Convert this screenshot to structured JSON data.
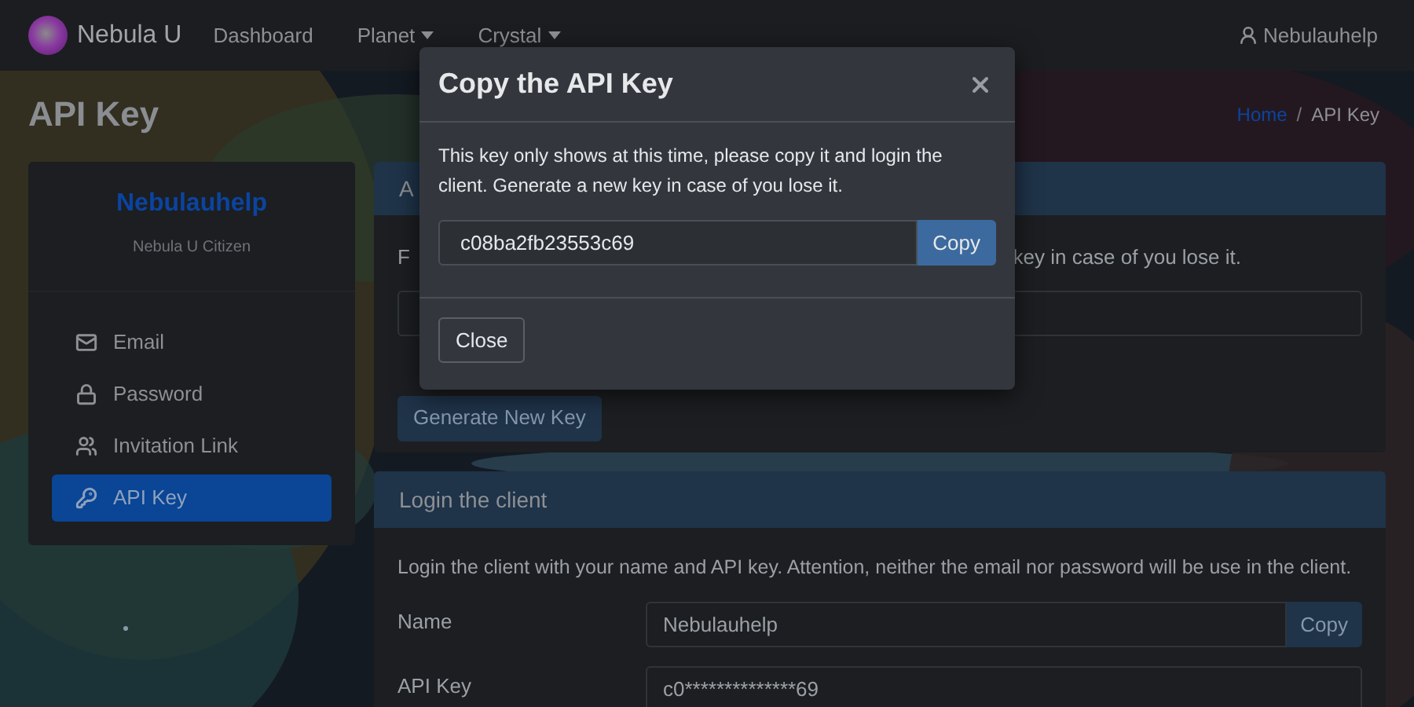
{
  "navbar": {
    "brand": "Nebula U",
    "links": [
      {
        "label": "Dashboard",
        "dropdown": false
      },
      {
        "label": "Planet",
        "dropdown": true
      },
      {
        "label": "Crystal",
        "dropdown": true
      }
    ],
    "user": "Nebulauhelp"
  },
  "page_title": "API Key",
  "breadcrumb_separator": "/",
  "breadcrumb": [
    {
      "label": "Home",
      "selected": false
    },
    {
      "label": "API Key",
      "selected": true
    }
  ],
  "profile": {
    "name": "Nebulauhelp",
    "role": "Nebula U Citizen"
  },
  "sidebar": {
    "items": [
      {
        "label": "Email",
        "selected": false
      },
      {
        "label": "Password",
        "selected": false
      },
      {
        "label": "Invitation Link",
        "selected": false
      },
      {
        "label": "API Key",
        "selected": true
      }
    ]
  },
  "key_card": {
    "header": "A",
    "text_start": "F",
    "text_end": "key in case of you lose it.",
    "button": "Generate New Key"
  },
  "login_card": {
    "header": "Login the client",
    "text": "Login the client with your name and API key. Attention, neither the email nor password will be use in the client.",
    "fields": [
      {
        "label": "Name",
        "value": "Nebulauhelp",
        "copy": "Copy"
      },
      {
        "label": "API Key",
        "value": "c0**************69"
      }
    ]
  },
  "modal": {
    "title": "Copy the API Key",
    "text": "This key only shows at this time, please copy it and login the client. Generate a new key in case of you lose it.",
    "key": "c08ba2fb23553c69",
    "copy": "Copy",
    "button": "Close"
  }
}
